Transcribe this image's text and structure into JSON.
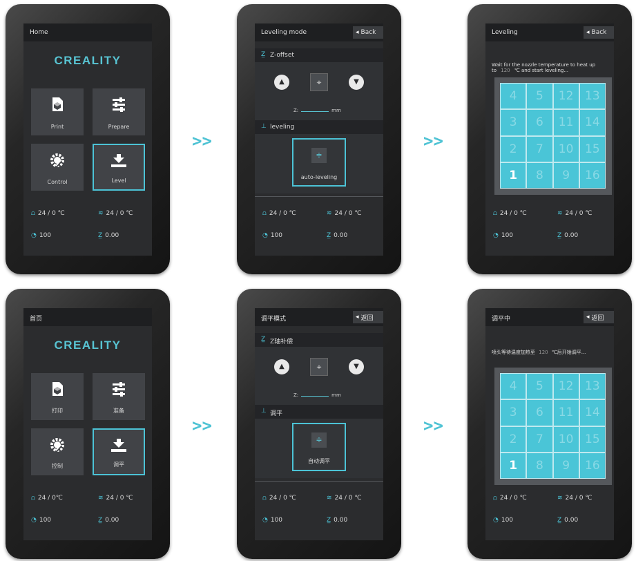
{
  "colors": {
    "accent": "#4cc3d6",
    "screen_bg": "#2b2c2e",
    "grid": "#4ac5d7"
  },
  "arrows": [
    ">>",
    ">>",
    ">>",
    ">>"
  ],
  "screens": {
    "home_en": {
      "title": "Home",
      "logo": "CREALITY",
      "tiles": [
        {
          "label": "Print",
          "icon": "cube-file-icon"
        },
        {
          "label": "Prepare",
          "icon": "sliders-icon"
        },
        {
          "label": "Control",
          "icon": "wrench-gear-icon"
        },
        {
          "label": "Level",
          "icon": "leveling-icon"
        }
      ],
      "stats": {
        "nozzle": "24 / 0 ℃",
        "bed": "24 / 0 ℃",
        "speed": "100",
        "z": "0.00"
      }
    },
    "home_cn": {
      "title": "首页",
      "logo": "CREALITY",
      "tiles": [
        {
          "label": "打印",
          "icon": "cube-file-icon"
        },
        {
          "label": "准备",
          "icon": "sliders-icon"
        },
        {
          "label": "控制",
          "icon": "wrench-gear-icon"
        },
        {
          "label": "调平",
          "icon": "leveling-icon"
        }
      ],
      "stats": {
        "nozzle": "24 / 0℃",
        "bed": "24 / 0 ℃",
        "speed": "100",
        "z": "0.00"
      }
    },
    "mode_en": {
      "title": "Leveling mode",
      "back": "Back",
      "zoffset": "Z-offset",
      "z_label": "Z:",
      "z_unit": "mm",
      "leveling": "leveling",
      "auto": "auto-leveling",
      "stats": {
        "nozzle": "24 / 0   ℃",
        "bed": "24 / 0   ℃",
        "speed": "100",
        "z": "0.00"
      }
    },
    "mode_cn": {
      "title": "调平模式",
      "back": "返回",
      "zoffset": "Z轴补偿",
      "z_label": "Z:",
      "z_unit": "mm",
      "leveling": "调平",
      "auto": "自动调平",
      "stats": {
        "nozzle": "24 / 0   ℃",
        "bed": "24 / 0   ℃",
        "speed": "100",
        "z": "0.00"
      }
    },
    "level_en": {
      "title": "Leveling",
      "back": "Back",
      "wait_a": "Wait for the nozzle temperature to heat up",
      "wait_b": "to",
      "temp": "120",
      "wait_c": "℃ and start leveling...",
      "stats": {
        "nozzle": "24 / 0   ℃",
        "bed": "24 / 0   ℃",
        "speed": "100",
        "z": "0.00"
      }
    },
    "level_cn": {
      "title": "调平中",
      "back": "返回",
      "wait_a": "喷头等待温度加热至",
      "temp": "120",
      "wait_c": "℃后开始调平...",
      "stats": {
        "nozzle": "24 / 0   ℃",
        "bed": "24 / 0   ℃",
        "speed": "100",
        "z": "0.00"
      }
    }
  },
  "grid_numbers": [
    "4",
    "5",
    "12",
    "13",
    "3",
    "6",
    "11",
    "14",
    "2",
    "7",
    "10",
    "15",
    "1",
    "8",
    "9",
    "16"
  ],
  "grid_active": "1"
}
